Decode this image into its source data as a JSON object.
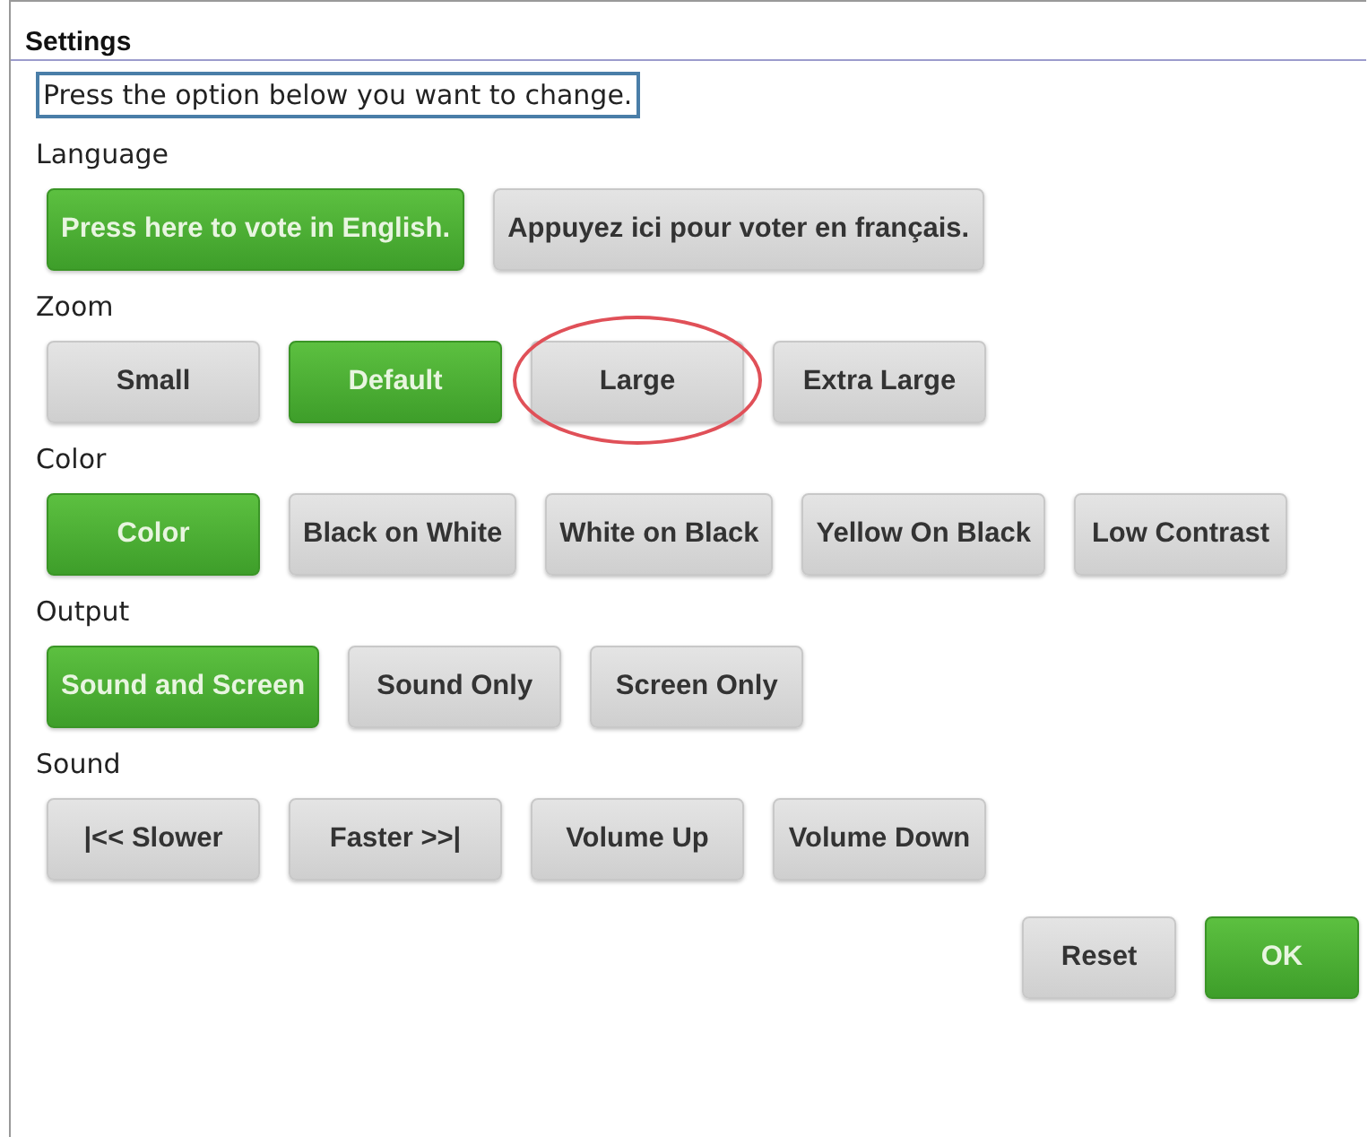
{
  "window": {
    "title": "Settings"
  },
  "instruction": "Press the option below you want to change.",
  "sections": [
    {
      "label": "Language",
      "options": [
        {
          "label": "Press here to vote in English.",
          "selected": true,
          "circled": false
        },
        {
          "label": "Appuyez ici pour voter en français.",
          "selected": false,
          "circled": false
        }
      ]
    },
    {
      "label": "Zoom",
      "options": [
        {
          "label": "Small",
          "selected": false,
          "circled": false
        },
        {
          "label": "Default",
          "selected": true,
          "circled": false
        },
        {
          "label": "Large",
          "selected": false,
          "circled": true
        },
        {
          "label": "Extra Large",
          "selected": false,
          "circled": false
        }
      ]
    },
    {
      "label": "Color",
      "options": [
        {
          "label": "Color",
          "selected": true,
          "circled": false
        },
        {
          "label": "Black on White",
          "selected": false,
          "circled": false
        },
        {
          "label": "White on Black",
          "selected": false,
          "circled": false
        },
        {
          "label": "Yellow On Black",
          "selected": false,
          "circled": false
        },
        {
          "label": "Low Contrast",
          "selected": false,
          "circled": false
        }
      ]
    },
    {
      "label": "Output",
      "options": [
        {
          "label": "Sound and Screen",
          "selected": true,
          "circled": false
        },
        {
          "label": "Sound Only",
          "selected": false,
          "circled": false
        },
        {
          "label": "Screen Only",
          "selected": false,
          "circled": false
        }
      ]
    },
    {
      "label": "Sound",
      "options": [
        {
          "label": "|<< Slower",
          "selected": false,
          "circled": false
        },
        {
          "label": "Faster >>|",
          "selected": false,
          "circled": false
        },
        {
          "label": "Volume Up",
          "selected": false,
          "circled": false
        },
        {
          "label": "Volume Down",
          "selected": false,
          "circled": false
        }
      ]
    }
  ],
  "footer_buttons": [
    {
      "label": "Reset",
      "primary": false
    },
    {
      "label": "OK",
      "primary": true
    }
  ]
}
